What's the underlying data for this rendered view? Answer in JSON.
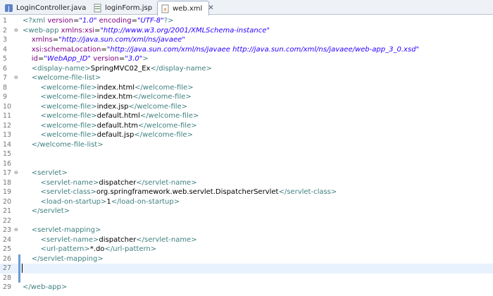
{
  "tabs": [
    {
      "label": "LoginController.java",
      "icon": "java-file-icon",
      "active": false
    },
    {
      "label": "loginForm.jsp",
      "icon": "jsp-file-icon",
      "active": false
    },
    {
      "label": "web.xml",
      "icon": "xml-file-icon",
      "active": true,
      "close": "✕"
    }
  ],
  "lines": [
    {
      "n": "1",
      "fold": "",
      "segs": [
        [
          "pi",
          "<?xml "
        ],
        [
          "attr",
          "version"
        ],
        [
          "txt",
          "="
        ],
        [
          "val",
          "\"1.0\""
        ],
        [
          "txt",
          " "
        ],
        [
          "attr",
          "encoding"
        ],
        [
          "txt",
          "="
        ],
        [
          "val",
          "\"UTF-8\""
        ],
        [
          "pi",
          "?>"
        ]
      ]
    },
    {
      "n": "2",
      "fold": "⊖",
      "segs": [
        [
          "tag",
          "<web-app "
        ],
        [
          "attr",
          "xmlns:xsi"
        ],
        [
          "txt",
          "="
        ],
        [
          "val",
          "\"http://www.w3.org/2001/XMLSchema-instance\""
        ]
      ]
    },
    {
      "n": "3",
      "fold": "",
      "segs": [
        [
          "txt",
          "    "
        ],
        [
          "attr",
          "xmlns"
        ],
        [
          "txt",
          "="
        ],
        [
          "val",
          "\"http://java.sun.com/xml/ns/javaee\""
        ]
      ]
    },
    {
      "n": "4",
      "fold": "",
      "segs": [
        [
          "txt",
          "    "
        ],
        [
          "attr",
          "xsi:schemaLocation"
        ],
        [
          "txt",
          "="
        ],
        [
          "val",
          "\"http://java.sun.com/xml/ns/javaee http://java.sun.com/xml/ns/javaee/web-app_3_0.xsd\""
        ]
      ]
    },
    {
      "n": "5",
      "fold": "",
      "segs": [
        [
          "txt",
          "    "
        ],
        [
          "attr",
          "id"
        ],
        [
          "txt",
          "="
        ],
        [
          "val",
          "\"WebApp_ID\""
        ],
        [
          "txt",
          " "
        ],
        [
          "attr",
          "version"
        ],
        [
          "txt",
          "="
        ],
        [
          "val",
          "\"3.0\""
        ],
        [
          "tag",
          ">"
        ]
      ]
    },
    {
      "n": "6",
      "fold": "",
      "segs": [
        [
          "txt",
          "    "
        ],
        [
          "tag",
          "<display-name>"
        ],
        [
          "txt",
          "SpringMVC02_Ex"
        ],
        [
          "tag",
          "</display-name>"
        ]
      ]
    },
    {
      "n": "7",
      "fold": "⊖",
      "segs": [
        [
          "txt",
          "    "
        ],
        [
          "tag",
          "<welcome-file-list>"
        ]
      ]
    },
    {
      "n": "8",
      "fold": "",
      "segs": [
        [
          "txt",
          "        "
        ],
        [
          "tag",
          "<welcome-file>"
        ],
        [
          "txt",
          "index.html"
        ],
        [
          "tag",
          "</welcome-file>"
        ]
      ]
    },
    {
      "n": "9",
      "fold": "",
      "segs": [
        [
          "txt",
          "        "
        ],
        [
          "tag",
          "<welcome-file>"
        ],
        [
          "txt",
          "index.htm"
        ],
        [
          "tag",
          "</welcome-file>"
        ]
      ]
    },
    {
      "n": "10",
      "fold": "",
      "segs": [
        [
          "txt",
          "        "
        ],
        [
          "tag",
          "<welcome-file>"
        ],
        [
          "txt",
          "index.jsp"
        ],
        [
          "tag",
          "</welcome-file>"
        ]
      ]
    },
    {
      "n": "11",
      "fold": "",
      "segs": [
        [
          "txt",
          "        "
        ],
        [
          "tag",
          "<welcome-file>"
        ],
        [
          "txt",
          "default.html"
        ],
        [
          "tag",
          "</welcome-file>"
        ]
      ]
    },
    {
      "n": "12",
      "fold": "",
      "segs": [
        [
          "txt",
          "        "
        ],
        [
          "tag",
          "<welcome-file>"
        ],
        [
          "txt",
          "default.htm"
        ],
        [
          "tag",
          "</welcome-file>"
        ]
      ]
    },
    {
      "n": "13",
      "fold": "",
      "segs": [
        [
          "txt",
          "        "
        ],
        [
          "tag",
          "<welcome-file>"
        ],
        [
          "txt",
          "default.jsp"
        ],
        [
          "tag",
          "</welcome-file>"
        ]
      ]
    },
    {
      "n": "14",
      "fold": "",
      "segs": [
        [
          "txt",
          "    "
        ],
        [
          "tag",
          "</welcome-file-list>"
        ]
      ]
    },
    {
      "n": "15",
      "fold": "",
      "segs": []
    },
    {
      "n": "16",
      "fold": "",
      "segs": []
    },
    {
      "n": "17",
      "fold": "⊖",
      "segs": [
        [
          "txt",
          "    "
        ],
        [
          "tag",
          "<servlet>"
        ]
      ]
    },
    {
      "n": "18",
      "fold": "",
      "segs": [
        [
          "txt",
          "        "
        ],
        [
          "tag",
          "<servlet-name>"
        ],
        [
          "txt",
          "dispatcher"
        ],
        [
          "tag",
          "</servlet-name>"
        ]
      ]
    },
    {
      "n": "19",
      "fold": "",
      "segs": [
        [
          "txt",
          "        "
        ],
        [
          "tag",
          "<servlet-class>"
        ],
        [
          "txt",
          "org.springframework.web.servlet.DispatcherServlet"
        ],
        [
          "tag",
          "</servlet-class>"
        ]
      ]
    },
    {
      "n": "20",
      "fold": "",
      "segs": [
        [
          "txt",
          "        "
        ],
        [
          "tag",
          "<load-on-startup>"
        ],
        [
          "txt",
          "1"
        ],
        [
          "tag",
          "</load-on-startup>"
        ]
      ]
    },
    {
      "n": "21",
      "fold": "",
      "segs": [
        [
          "txt",
          "    "
        ],
        [
          "tag",
          "</servlet>"
        ]
      ]
    },
    {
      "n": "22",
      "fold": "",
      "segs": []
    },
    {
      "n": "23",
      "fold": "⊖",
      "segs": [
        [
          "txt",
          "    "
        ],
        [
          "tag",
          "<servlet-mapping>"
        ]
      ]
    },
    {
      "n": "24",
      "fold": "",
      "segs": [
        [
          "txt",
          "        "
        ],
        [
          "tag",
          "<servlet-name>"
        ],
        [
          "txt",
          "dispatcher"
        ],
        [
          "tag",
          "</servlet-name>"
        ]
      ]
    },
    {
      "n": "25",
      "fold": "",
      "segs": [
        [
          "txt",
          "        "
        ],
        [
          "tag",
          "<url-pattern>"
        ],
        [
          "txt",
          "*.do"
        ],
        [
          "tag",
          "</url-pattern>"
        ]
      ]
    },
    {
      "n": "26",
      "fold": "",
      "segs": [
        [
          "txt",
          "    "
        ],
        [
          "tag",
          "</servlet-mapping>"
        ]
      ]
    },
    {
      "n": "27",
      "fold": "",
      "segs": [],
      "current": true
    },
    {
      "n": "28",
      "fold": "",
      "segs": []
    },
    {
      "n": "29",
      "fold": "",
      "segs": [
        [
          "tag",
          "</web-app>"
        ]
      ]
    }
  ],
  "changed_lines": [
    "26",
    "27",
    "28"
  ],
  "colors": {
    "tag": "#3f7f7f",
    "attr": "#7f007f",
    "value": "#2a00ff",
    "text": "#000000"
  }
}
